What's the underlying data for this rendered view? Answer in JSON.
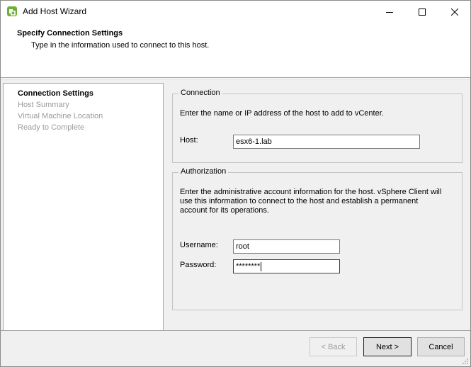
{
  "window": {
    "title": "Add Host Wizard"
  },
  "header": {
    "title": "Specify Connection Settings",
    "subtitle": "Type in the information used to connect to this host."
  },
  "steps": [
    {
      "label": "Connection Settings",
      "active": true
    },
    {
      "label": "Host Summary",
      "active": false
    },
    {
      "label": "Virtual Machine Location",
      "active": false
    },
    {
      "label": "Ready to Complete",
      "active": false
    }
  ],
  "connection": {
    "legend": "Connection",
    "description": "Enter the name or IP address of the host to add to vCenter.",
    "host_label": "Host:",
    "host_value": "esx6-1.lab"
  },
  "authorization": {
    "legend": "Authorization",
    "description_line1": "Enter the administrative account information for the host. vSphere Client will",
    "description_line2": "use this information to connect to the host and establish a permanent",
    "description_line3": "account for its operations.",
    "username_label": "Username:",
    "username_value": "root",
    "password_label": "Password:",
    "password_value": "********"
  },
  "footer": {
    "back_label": "< Back",
    "next_label": "Next >",
    "cancel_label": "Cancel"
  },
  "icons": {
    "app": "vsphere-logo-icon",
    "minimize": "minimize-icon",
    "maximize": "maximize-icon",
    "close": "close-icon"
  }
}
